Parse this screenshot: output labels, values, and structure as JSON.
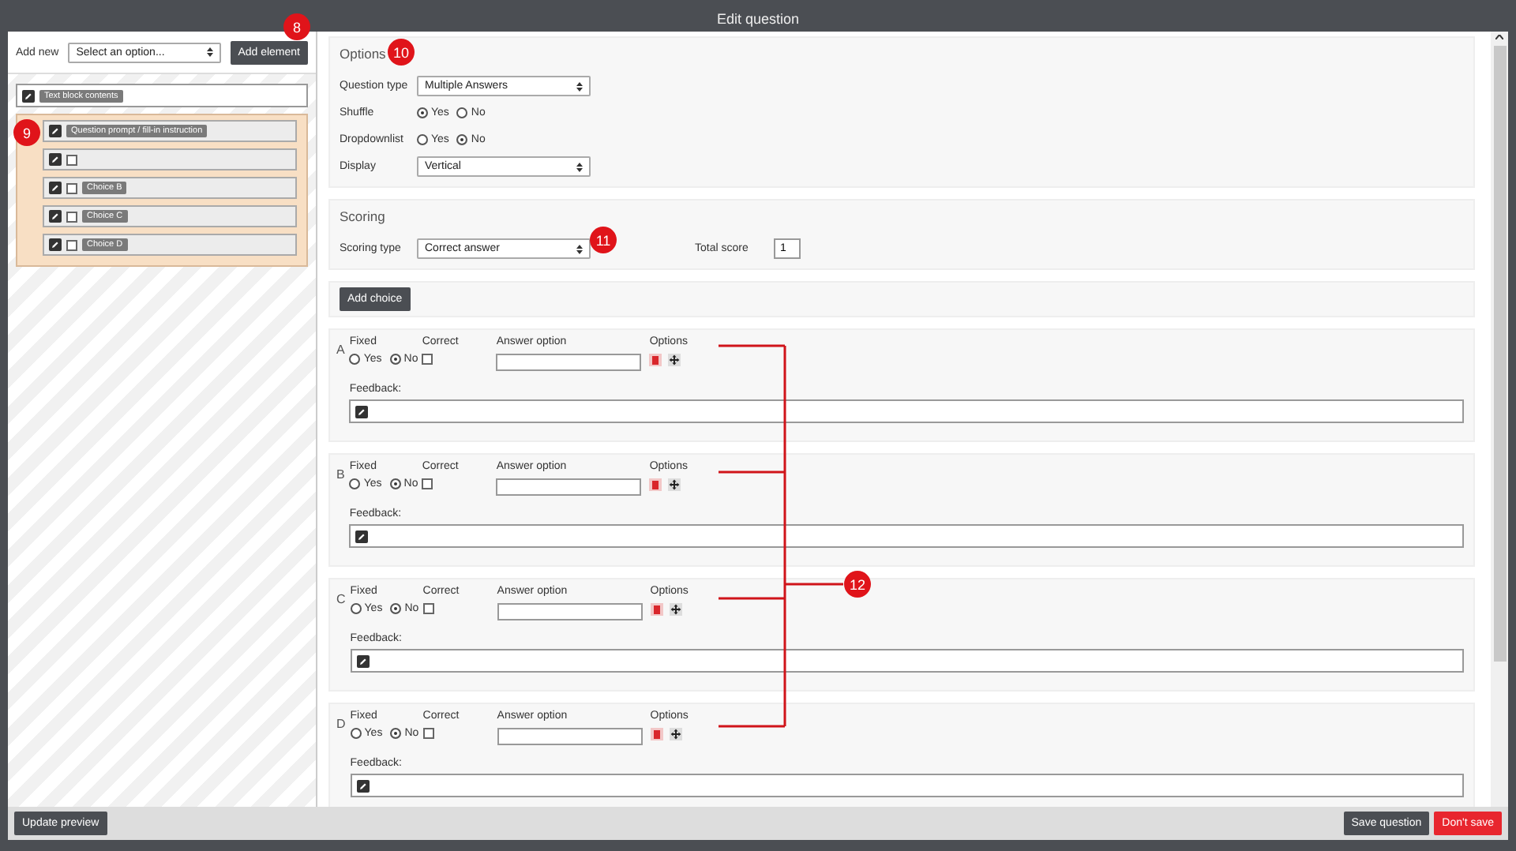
{
  "window": {
    "title": "Edit question"
  },
  "left_panel": {
    "add_label": "Add new",
    "select_value": "Select an option...",
    "add_button": "Add element",
    "items": [
      {
        "kind": "text_block",
        "label": "Text block contents"
      },
      {
        "kind": "group",
        "children": [
          {
            "kind": "prompt",
            "label": "Question prompt / fill-in instruction"
          },
          {
            "kind": "choice",
            "checked": false
          },
          {
            "kind": "choice",
            "label": "Choice B",
            "checked": false
          },
          {
            "kind": "choice",
            "label": "Choice C",
            "checked": false
          },
          {
            "kind": "choice",
            "label": "Choice D",
            "checked": false
          }
        ]
      }
    ]
  },
  "options": {
    "title": "Options",
    "fields": [
      {
        "kind": "select",
        "label": "Question type",
        "value": "Multiple Answers"
      },
      {
        "kind": "radio",
        "label": "Shuffle",
        "options": [
          {
            "label": "Yes",
            "selected": true
          },
          {
            "label": "No",
            "selected": false
          }
        ]
      },
      {
        "kind": "radio",
        "label": "Dropdownlist",
        "options": [
          {
            "label": "Yes",
            "selected": false
          },
          {
            "label": "No",
            "selected": true
          }
        ]
      },
      {
        "kind": "select",
        "label": "Display",
        "value": "Vertical"
      }
    ]
  },
  "scoring": {
    "title": "Scoring",
    "type_label": "Scoring type",
    "type_value": "Correct answer",
    "total_label": "Total score",
    "total_value": "1"
  },
  "add_choice": "Add choice",
  "choices": [
    {
      "letter": "A",
      "fixed_label": "Fixed",
      "fixed_options": [
        {
          "label": "Yes",
          "selected": false
        },
        {
          "label": "No",
          "selected": true
        }
      ],
      "correct_label": "Correct",
      "correct": false,
      "answer_label": "Answer option",
      "options_label": "Options",
      "feedback_label": "Feedback:"
    },
    {
      "letter": "B",
      "fixed_label": "Fixed",
      "fixed_options": [
        {
          "label": "Yes",
          "selected": false
        },
        {
          "label": "No",
          "selected": true
        }
      ],
      "correct_label": "Correct",
      "correct": false,
      "answer_label": "Answer option",
      "options_label": "Options",
      "feedback_label": "Feedback:"
    },
    {
      "letter": "C",
      "fixed_label": "Fixed",
      "fixed_options": [
        {
          "label": "Yes",
          "selected": false
        },
        {
          "label": "No",
          "selected": true
        }
      ],
      "correct_label": "Correct",
      "correct": false,
      "answer_label": "Answer option",
      "options_label": "Options",
      "feedback_label": "Feedback:"
    },
    {
      "letter": "D",
      "fixed_label": "Fixed",
      "fixed_options": [
        {
          "label": "Yes",
          "selected": false
        },
        {
          "label": "No",
          "selected": true
        }
      ],
      "correct_label": "Correct",
      "correct": false,
      "answer_label": "Answer option",
      "options_label": "Options",
      "feedback_label": "Feedback:"
    }
  ],
  "footer": {
    "update_button": "Update preview",
    "save_button": "Save question",
    "dont_save_button": "Don't save"
  },
  "callouts": [
    "8",
    "9",
    "10",
    "11",
    "12"
  ]
}
